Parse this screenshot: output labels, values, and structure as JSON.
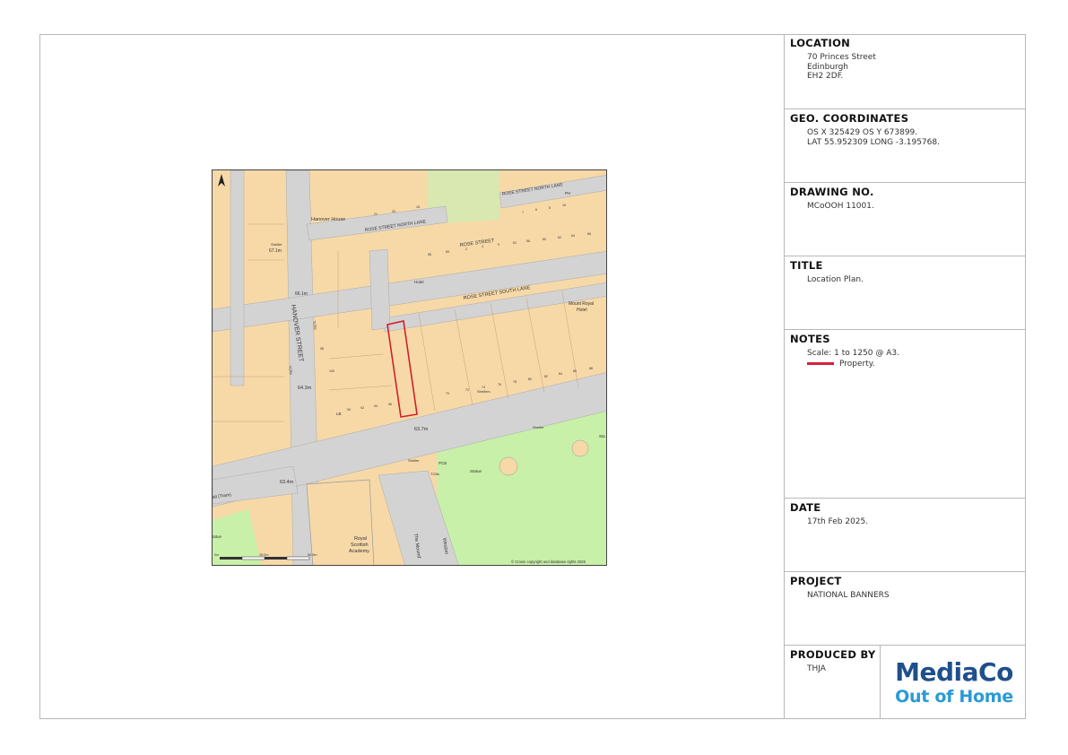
{
  "location": {
    "heading": "LOCATION",
    "lines": [
      "70 Princes Street",
      "Edinburgh",
      "EH2 2DF."
    ]
  },
  "geo": {
    "heading": "GEO. COORDINATES",
    "lines": [
      "OS X 325429 OS Y 673899.",
      "LAT 55.952309 LONG -3.195768."
    ]
  },
  "drawing": {
    "heading": "DRAWING NO.",
    "value": "MCoOOH 11001."
  },
  "title": {
    "heading": "TITLE",
    "value": "Location Plan."
  },
  "notes": {
    "heading": "NOTES",
    "scale": "Scale: 1 to 1250 @ A3.",
    "legend_label": "Property.",
    "legend_color": "#d6203a"
  },
  "date": {
    "heading": "DATE",
    "value": "17th Feb 2025."
  },
  "project": {
    "heading": "PROJECT",
    "value": "NATIONAL BANNERS"
  },
  "produced": {
    "heading": "PRODUCED BY",
    "value": "THJA",
    "logo_line1": "MediaCo",
    "logo_line2": "Out of Home"
  },
  "map": {
    "streets": {
      "hanover": "HANOVER STREET",
      "rose_north_lane": "ROSE STREET NORTH LANE",
      "rose_north_lane_2": "ROSE STREET NORTH LANE",
      "rose": "ROSE STREET",
      "rose_south_lane": "ROSE STREET SOUTH LANE",
      "the_mound": "The Mound",
      "weston": "Weston",
      "tram": "ail (Tram)"
    },
    "buildings": {
      "hanover_house": "Hanover House",
      "mount_royal": "Mount Royal",
      "mount_royal_2": "Hotel",
      "hotel": "Hotel",
      "rsa_1": "Royal",
      "rsa_2": "Scottish",
      "rsa_3": "Academy",
      "pcb": "PCB",
      "statue": "Statue",
      "statue_left": "tatue"
    },
    "spot_heights": {
      "a": "67.1m",
      "b": "66.1m",
      "c": "64.3m",
      "d": "63.7m",
      "e": "63.4m"
    },
    "labels": {
      "shelter_a": "Shelter",
      "shelters": "Shelters",
      "shelter_b": "Shelter",
      "shelter_c": "Shelter",
      "tcbs": "TCBs",
      "tcbs_2": "TCBs",
      "tcbs_3": "TCBs",
      "lb": "LB",
      "ph": "PH",
      "sta": "Sta",
      "copyright": "© Crown copyright and database rights 2025"
    },
    "scalebar": {
      "zero": "0m",
      "mid": "25.0m",
      "end": "50.0m"
    },
    "numbers": [
      "21",
      "23",
      "15",
      "7",
      "6",
      "5",
      "16",
      "58",
      "59",
      "2",
      "4",
      "9",
      "52",
      "56",
      "60",
      "62",
      "64",
      "66",
      "70",
      "72",
      "74",
      "76",
      "78",
      "80",
      "82",
      "84",
      "86",
      "88",
      "90",
      "92",
      "94",
      "96",
      "98",
      "100"
    ],
    "colors": {
      "building": "#f7d9a8",
      "road": "#d3d3d3",
      "park": "#c8f0a8",
      "property_outline": "#d0202a"
    }
  }
}
